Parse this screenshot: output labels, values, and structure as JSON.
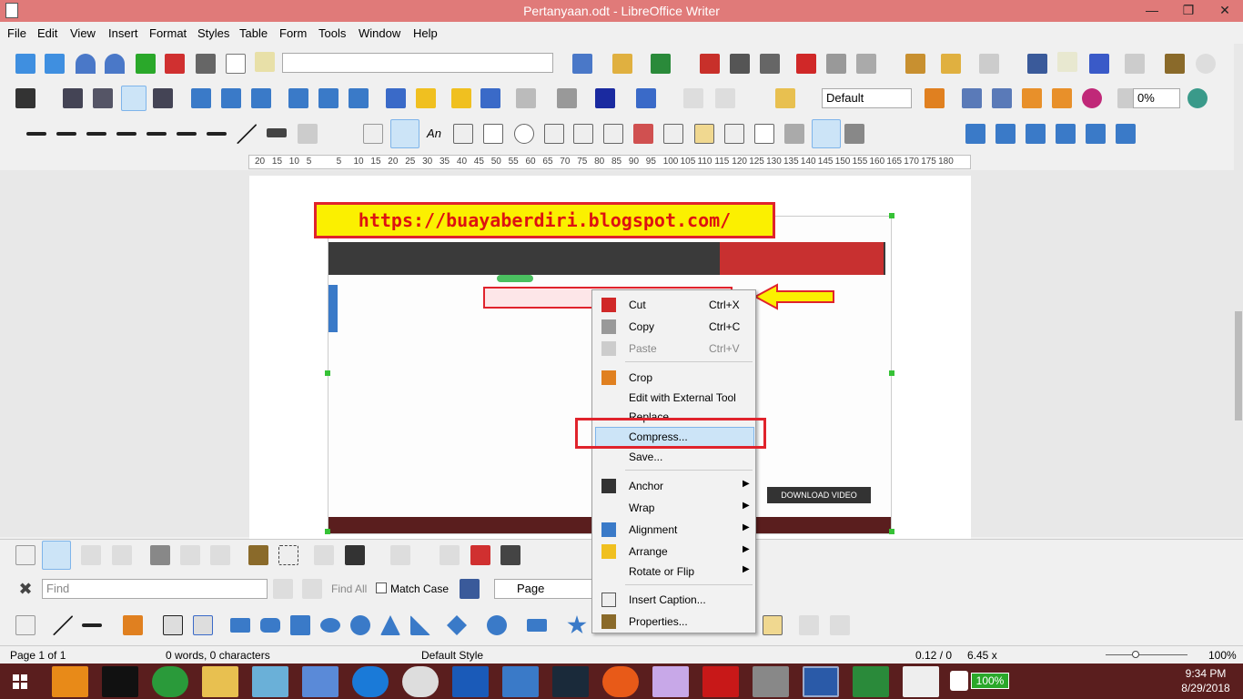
{
  "window": {
    "title": "Pertanyaan.odt - LibreOffice Writer"
  },
  "menubar": [
    "File",
    "Edit",
    "View",
    "Insert",
    "Format",
    "Styles",
    "Table",
    "Form",
    "Tools",
    "Window",
    "Help"
  ],
  "toolbar": {
    "style_combo": "Default",
    "zoom_combo": "0%"
  },
  "ruler": [
    "20",
    "15",
    "10",
    "5",
    "5",
    "10",
    "15",
    "20",
    "25",
    "30",
    "35",
    "40",
    "45",
    "50",
    "55",
    "60",
    "65",
    "70",
    "75",
    "80",
    "85",
    "90",
    "95",
    "100",
    "105",
    "110",
    "115",
    "120",
    "125",
    "130",
    "135",
    "140",
    "145",
    "150",
    "155",
    "160",
    "165",
    "170",
    "175",
    "180"
  ],
  "document": {
    "url_banner": "https://buayaberdiri.blogspot.com/",
    "video_button": "DOWNLOAD VIDEO"
  },
  "context_menu": {
    "cut": {
      "label": "Cut",
      "shortcut": "Ctrl+X"
    },
    "copy": {
      "label": "Copy",
      "shortcut": "Ctrl+C"
    },
    "paste": {
      "label": "Paste",
      "shortcut": "Ctrl+V"
    },
    "crop": "Crop",
    "edit_external": "Edit with External Tool",
    "replace": "Replace",
    "compress": "Compress...",
    "save": "Save...",
    "anchor": "Anchor",
    "wrap": "Wrap",
    "alignment": "Alignment",
    "arrange": "Arrange",
    "rotate": "Rotate or Flip",
    "insert_caption": "Insert Caption...",
    "properties": "Properties..."
  },
  "findbar": {
    "placeholder": "Find",
    "find_all": "Find All",
    "match_case": "Match Case",
    "page_combo": "Page"
  },
  "status": {
    "page": "Page 1 of 1",
    "words": "0 words, 0 characters",
    "style": "Default Style",
    "position": "0.12 / 0",
    "size": "6.45 x",
    "zoom": "100%"
  },
  "taskbar": {
    "battery": "100%",
    "time": "9:34 PM",
    "date": "8/29/2018"
  }
}
